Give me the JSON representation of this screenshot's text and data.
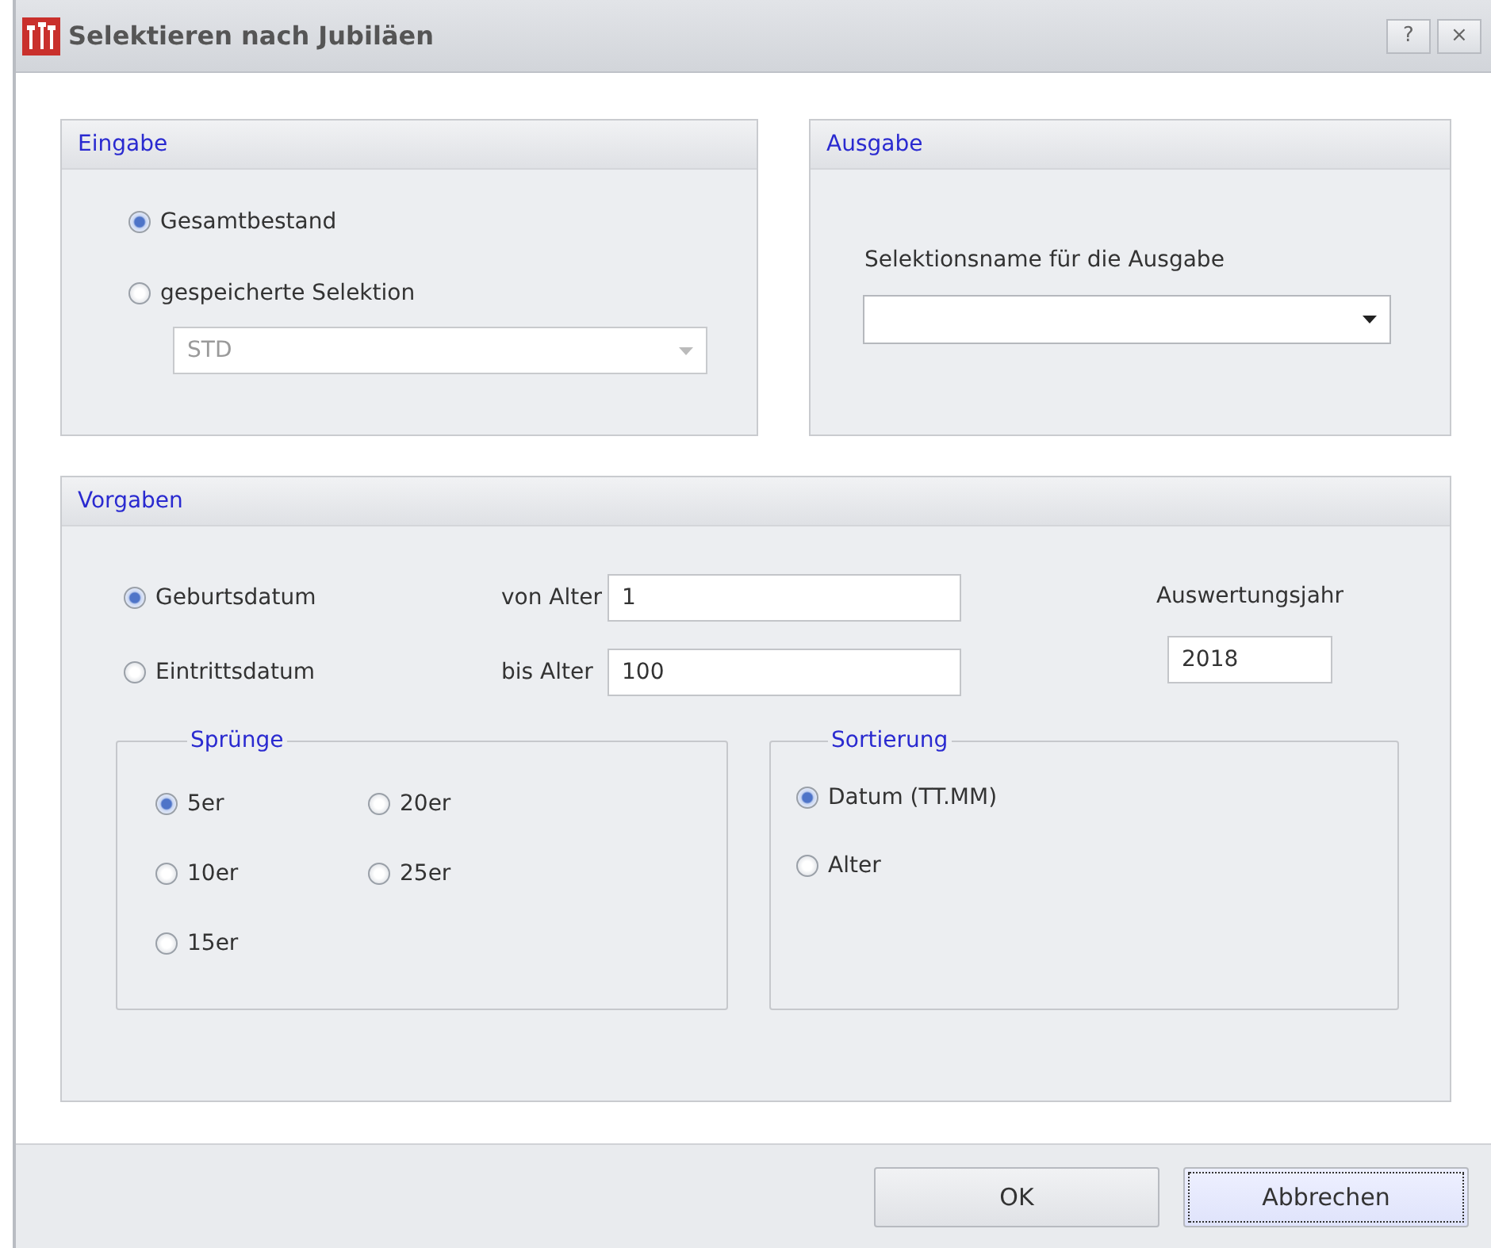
{
  "window": {
    "title": "Selektieren nach Jubiläen",
    "buttons": [
      "?",
      "×"
    ]
  },
  "eingabe": {
    "title": "Eingabe",
    "options": [
      {
        "label": "Gesamtbestand",
        "selected": true
      },
      {
        "label": "gespeicherte Selektion",
        "selected": false
      }
    ],
    "selection": {
      "value": "STD",
      "disabled": true
    }
  },
  "ausgabe": {
    "title": "Ausgabe",
    "label": "Selektionsname für die Ausgabe"
  },
  "vorgaben": {
    "title": "Vorgaben",
    "date_options": [
      {
        "label": "Geburtsdatum",
        "selected": true
      },
      {
        "label": "Eintrittsdatum",
        "selected": false
      }
    ],
    "age_fields": [
      {
        "label": "von Alter",
        "value": "1"
      },
      {
        "label": "bis Alter",
        "value": "100"
      }
    ],
    "year": {
      "label": "Auswertungsjahr",
      "value": "2018"
    },
    "spruenge": {
      "title": "Sprünge",
      "options": [
        {
          "label": "5er",
          "selected": true
        },
        {
          "label": "20er",
          "selected": false
        },
        {
          "label": "10er",
          "selected": false
        },
        {
          "label": "25er",
          "selected": false
        },
        {
          "label": "15er",
          "selected": false
        }
      ]
    },
    "sortierung": {
      "title": "Sortierung",
      "options": [
        {
          "label": "Datum (TT.MM)",
          "selected": true
        },
        {
          "label": "Alter",
          "selected": false
        }
      ]
    }
  },
  "buttons": [
    {
      "label": "OK",
      "focused": false
    },
    {
      "label": "Abbrechen",
      "focused": true
    }
  ]
}
